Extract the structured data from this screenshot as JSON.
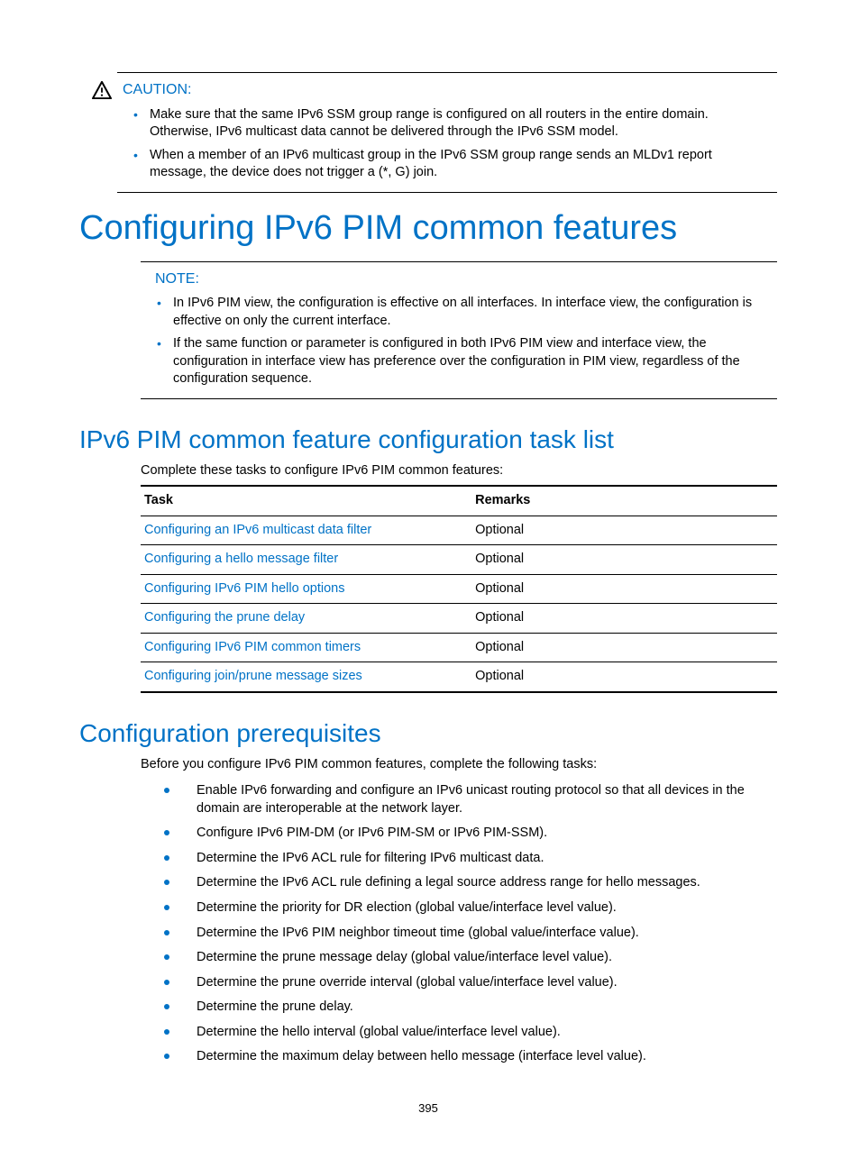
{
  "caution": {
    "label": "CAUTION:",
    "items": [
      "Make sure that the same IPv6 SSM group range is configured on all routers in the entire domain. Otherwise, IPv6 multicast data cannot be delivered through the IPv6 SSM model.",
      "When a member of an IPv6 multicast group in the IPv6 SSM group range sends an MLDv1 report message, the device does not trigger a (*, G) join."
    ]
  },
  "h1": "Configuring IPv6 PIM common features",
  "note": {
    "label": "NOTE:",
    "items": [
      "In IPv6 PIM view, the configuration is effective on all interfaces. In interface view, the configuration is effective on only the current interface.",
      "If the same function or parameter is configured in both IPv6 PIM view and interface view, the configuration in interface view has preference over the configuration in PIM view, regardless of the configuration sequence."
    ]
  },
  "h2a": "IPv6 PIM common feature configuration task list",
  "task_intro": "Complete these tasks to configure IPv6 PIM common features:",
  "table": {
    "headers": {
      "task": "Task",
      "remarks": "Remarks"
    },
    "rows": [
      {
        "task": "Configuring an IPv6 multicast data filter",
        "remarks": "Optional"
      },
      {
        "task": "Configuring a hello message filter",
        "remarks": "Optional"
      },
      {
        "task": "Configuring IPv6 PIM hello options",
        "remarks": "Optional"
      },
      {
        "task": "Configuring the prune delay",
        "remarks": "Optional"
      },
      {
        "task": "Configuring IPv6 PIM common timers",
        "remarks": "Optional"
      },
      {
        "task": "Configuring join/prune message sizes",
        "remarks": "Optional"
      }
    ]
  },
  "h2b": "Configuration prerequisites",
  "prereq_intro": "Before you configure IPv6 PIM common features, complete the following tasks:",
  "prereq_items": [
    "Enable IPv6 forwarding and configure an IPv6 unicast routing protocol so that all devices in the domain are interoperable at the network layer.",
    "Configure IPv6 PIM-DM (or IPv6 PIM-SM or IPv6 PIM-SSM).",
    "Determine the IPv6 ACL rule for filtering IPv6 multicast data.",
    "Determine the IPv6 ACL rule defining a legal source address range for hello messages.",
    "Determine the priority for DR election (global value/interface level value).",
    "Determine the IPv6 PIM neighbor timeout time (global value/interface value).",
    "Determine the prune message delay (global value/interface level value).",
    "Determine the prune override interval (global value/interface level value).",
    "Determine the prune delay.",
    "Determine the hello interval (global value/interface level value).",
    "Determine the maximum delay between hello message (interface level value)."
  ],
  "page_number": "395"
}
